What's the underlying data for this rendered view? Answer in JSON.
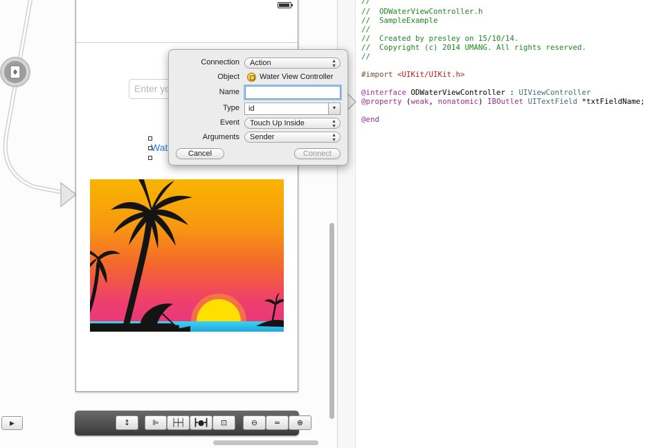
{
  "canvas": {
    "text_field_placeholder": "Enter yo",
    "button_label": "Water",
    "bottom_left_button_icon": "play-icon"
  },
  "bottom_bar": {
    "buttons": [
      {
        "icon": "resolve-issues-icon",
        "glyph": "↕"
      },
      {
        "icon": "align-icon",
        "glyph": "⊫"
      },
      {
        "icon": "pin-icon",
        "glyph": "├┼┤"
      },
      {
        "icon": "resizing-icon",
        "glyph": "┣●┫"
      },
      {
        "icon": "embed-icon",
        "glyph": "⊡"
      },
      {
        "icon": "zoom-out-icon",
        "glyph": "⊖"
      },
      {
        "icon": "zoom-fit-icon",
        "glyph": "="
      },
      {
        "icon": "zoom-in-icon",
        "glyph": "⊕"
      }
    ]
  },
  "popover": {
    "connection_label": "Connection",
    "connection_value": "Action",
    "object_label": "Object",
    "object_value": "Water View Controller",
    "name_label": "Name",
    "name_value": "",
    "type_label": "Type",
    "type_value": "id",
    "event_label": "Event",
    "event_value": "Touch Up Inside",
    "arguments_label": "Arguments",
    "arguments_value": "Sender",
    "cancel_label": "Cancel",
    "connect_label": "Connect"
  },
  "code": {
    "line_0": "//",
    "line_1": "//  ODWaterViewController.h",
    "line_2": "//  SampleExample",
    "line_3": "//",
    "line_4": "//  Created by presley on 15/10/14.",
    "line_5": "//  Copyright (c) 2014 UMANG. All rights reserved.",
    "line_6": "//",
    "import_kw": "#import",
    "import_path": "<UIKit/UIKit.h>",
    "interface_kw": "@interface",
    "interface_name": " ODWaterViewController : ",
    "interface_super": "UIViewController",
    "property_kw": "@property",
    "property_paren_open": " (",
    "property_weak": "weak",
    "property_comma": ", ",
    "property_nonatomic": "nonatomic",
    "property_paren_close": ") ",
    "property_outlet": "IBOutlet",
    "property_space": " ",
    "property_type": "UITextField",
    "property_name": " *txtFieldName;",
    "end_kw": "@end"
  },
  "colors": {
    "comment": "#1e8a1e",
    "keyword": "#a03090",
    "string": "#c41a16",
    "type": "#3f6e74",
    "button_text": "#2d7bd6"
  }
}
